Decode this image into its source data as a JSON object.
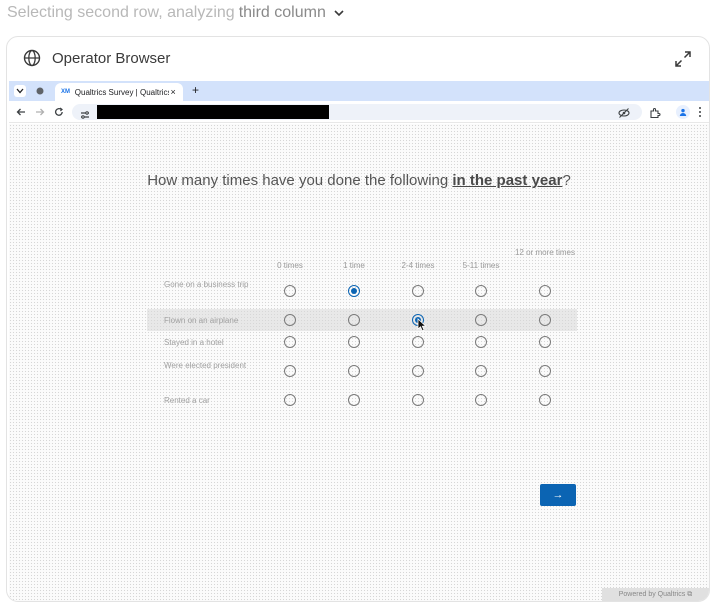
{
  "status": {
    "prefix": "Selecting second row, analyzing",
    "highlight": "third column"
  },
  "panel": {
    "title": "Operator Browser"
  },
  "browser": {
    "tab_favicon": "XM",
    "tab_title": "Qualtrics Survey | Qualtrics",
    "new_tab": "+",
    "tab_close": "×"
  },
  "survey": {
    "question_prefix": "How many times have you done the following ",
    "question_emphasis": "in the past year",
    "question_suffix": "?",
    "columns": [
      "0 times",
      "1 time",
      "2-4 times",
      "5-11 times",
      "12 or more times"
    ],
    "rows": [
      {
        "label": "Gone on a business trip",
        "selected": 1
      },
      {
        "label": "Flown on an airplane",
        "selected": 2
      },
      {
        "label": "Stayed in a hotel",
        "selected": -1
      },
      {
        "label": "Were elected president",
        "selected": -1
      },
      {
        "label": "Rented a car",
        "selected": -1
      }
    ],
    "next_label": "→",
    "powered_by": "Powered by Qualtrics ⧉"
  },
  "colors": {
    "accent": "#0b64b3",
    "tabstrip": "#d3e2fb"
  }
}
